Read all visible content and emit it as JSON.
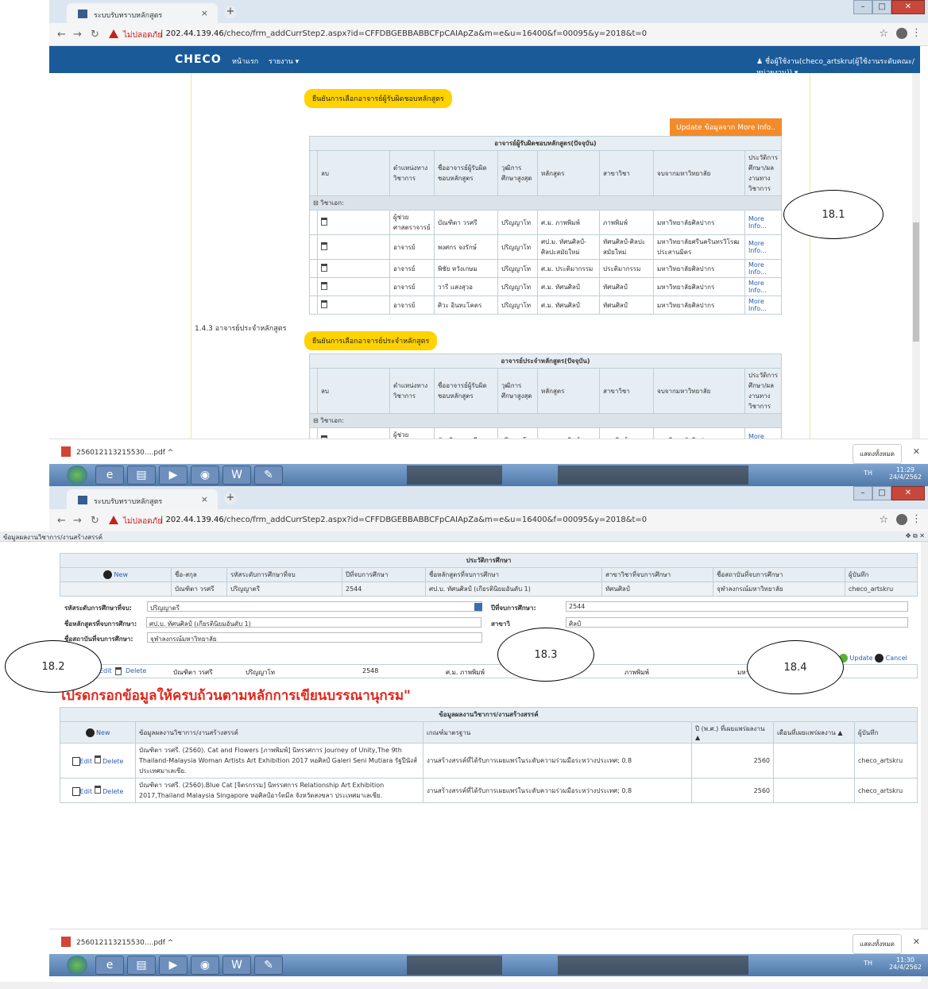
{
  "browser1": {
    "tab_title": "ระบบรับทราบหลักสูตร",
    "insecure_label": "ไม่ปลอดภัย",
    "url_host": "202.44.139.46",
    "url_path": "/checo/frm_addCurrStep2.aspx?id=CFFDBGEBBABBCFpCAIApZa&m=e&u=16400&f=00095&y=2018&t=0",
    "nav": {
      "logo": "CHECO",
      "home": "หน้าแรก",
      "report": "รายงาน ▾",
      "user": "♟ ชื่อผู้ใช้งาน(checo_artskru(ผู้ใช้งานระดับคณะ/หน่วยงาน)) ▾"
    },
    "confirm_btn": "ยืนยันการเลือกอาจารย์ผู้รับผิดชอบหลักสูตร",
    "update_btn": "Update ข้อมูลจาก More Info..",
    "section_143": "1.4.3 อาจารย์ประจำหลักสูตร",
    "confirm_btn2": "ยืนยันการเลือกอาจารย์ประจำหลักสูตร",
    "table1": {
      "caption": "อาจารย์ผู้รับผิดชอบหลักสูตร(ปัจจุบัน)",
      "headers": [
        "ลบ",
        "ตำแหน่งทางวิชาการ",
        "ชื่ออาจารย์ผู้รับผิดชอบหลักสูตร",
        "วุฒิการศึกษาสูงสุด",
        "หลักสูตร",
        "สาขาวิชา",
        "จบจากมหาวิทยาลัย",
        "ประวัติการศึกษา/ผลงานทางวิชาการ"
      ],
      "group": "⊟  วิชาเอก:",
      "rows": [
        [
          "ผู้ช่วยศาสตราจารย์",
          "บัณฑิตา วรศรี",
          "ปริญญาโท",
          "ศ.ม. ภาพพิมพ์",
          "ภาพพิมพ์",
          "มหาวิทยาลัยศิลปากร",
          "More Info..."
        ],
        [
          "อาจารย์",
          "พงศกร จงรักษ์",
          "ปริญญาโท",
          "ศป.ม. ทัศนศิลป์-ศิลปะสมัยใหม่",
          "ทัศนศิลป์-ศิลปะสมัยใหม่",
          "มหาวิทยาลัยศรีนครินทรวิโรฒประสานมิตร",
          "More Info..."
        ],
        [
          "อาจารย์",
          "พิชัย หวังเกษม",
          "ปริญญาโท",
          "ศ.ม. ประติมากรรม",
          "ประติมากรรม",
          "มหาวิทยาลัยศิลปากร",
          "More Info..."
        ],
        [
          "อาจารย์",
          "วารี แสงสุวอ",
          "ปริญญาโท",
          "ศ.ม. ทัศนศิลป์",
          "ทัศนศิลป์",
          "มหาวิทยาลัยศิลปากร",
          "More Info..."
        ],
        [
          "อาจารย์",
          "ศิวะ อินทะโคตร",
          "ปริญญาโท",
          "ศ.ม. ทัศนศิลป์",
          "ทัศนศิลป์",
          "มหาวิทยาลัยศิลปากร",
          "More Info..."
        ]
      ]
    },
    "table2": {
      "caption": "อาจารย์ประจำหลักสูตร(ปัจจุบัน)",
      "group": "⊟  วิชาเอก:",
      "rows": [
        [
          "ผู้ช่วยศาสตราจารย์",
          "บัณฑิตา วรศรี",
          "ปริญญาโท",
          "ศ.ม. ภาพพิมพ์",
          "ภาพพิมพ์",
          "มหาวิทยาลัยศิลปากร",
          "More Info..."
        ]
      ]
    },
    "download": "256012113215530....pdf  ^",
    "show_all": "แสดงทั้งหมด",
    "tray": "TH",
    "clock_time": "11:29",
    "clock_date": "24/4/2562"
  },
  "browser2": {
    "tab_title": "ระบบรับทราบหลักสูตร",
    "insecure_label": "ไม่ปลอดภัย",
    "url_host": "202.44.139.46",
    "url_path": "/checo/frm_addCurrStep2.aspx?id=CFFDBGEBBABBCFpCAIApZa&m=e&u=16400&f=00095&y=2018&t=0",
    "dialog_title": "ข้อมูลผลงานวิชาการ/งานสร้างสรรค์",
    "edu": {
      "caption": "ประวัติการศึกษา",
      "new": "New",
      "headers": [
        "ชื่อ-สกุล",
        "รหัสระดับการศึกษาที่จบ",
        "ปีที่จบการศึกษา",
        "ชื่อหลักสูตรที่จบการศึกษา",
        "สาขาวิชาที่จบการศึกษา",
        "ชื่อสถาบันที่จบการศึกษา",
        "ผู้บันทึก"
      ],
      "row": [
        "บัณฑิตา วรศรี",
        "ปริญญาตรี",
        "2544",
        "ศป.บ. ทัศนศิลป์ (เกียรตินิยมอันดับ 1)",
        "ทัศนศิลป์",
        "จุฬาลงกรณ์มหาวิทยาลัย",
        "checo_artskru"
      ],
      "row2": [
        "บัณฑิตา วรศรี",
        "ปริญญาโท",
        "2548",
        "ศ.ม. ภาพพิมพ์",
        "ภาพพิมพ์",
        "มหา"
      ],
      "edit": "Edit",
      "delete": "Delete"
    },
    "form": {
      "level_label": "รหัสระดับการศึกษาที่จบ:",
      "level_value": "ปริญญาตรี",
      "year_label": "ปีที่จบการศึกษา:",
      "year_value": "2544",
      "course_label": "ชื่อหลักสูตรที่จบการศึกษา:",
      "course_value": "ศป.บ. ทัศนศิลป์ (เกียรตินิยมอันดับ 1)",
      "major_label": "สาขาวิ",
      "major_value": "ศิลป์",
      "inst_label": "ชื่อสถาบันที่จบการศึกษา:",
      "inst_value": "จุฬาลงกรณ์มหาวิทยาลัย",
      "update": "Update",
      "cancel": "Cancel"
    },
    "red_notice": "โปรดกรอกข้อมูลให้ครบถ้วนตามหลักการเขียนบรรณานุกรม\"",
    "works": {
      "caption": "ข้อมูลผลงานวิชาการ/งานสร้างสรรค์",
      "new": "New",
      "headers": [
        "ข้อมูลผลงานวิชาการ/งานสร้างสรรค์",
        "เกณฑ์มาตรฐาน",
        "ปี (พ.ศ.) ที่เผยแพร่ผลงาน ▲",
        "เดือนที่เผยแพร่ผลงาน ▲",
        "ผู้บันทึก"
      ],
      "rows": [
        [
          "บัณฑิตา วรศรี. (2560). Cat and Flowers [ภาพพิมพ์] นิทรรศการ Journey of Unity,The 9th Thailand-Malaysia Woman Artists Art Exhibition 2017 หอศิลป์ Galeri Seni Mutiara รัฐปีนังส์ ประเทศมาเลเซีย.",
          "งานสร้างสรรค์ที่ได้รับการเผยแพร่ในระดับความร่วมมือระหว่างประเทศ; 0.8",
          "2560",
          "",
          "checo_artskru"
        ],
        [
          "บัณฑิตา วรศรี. (2560).Blue Cat [จิตรกรรม] นิทรรศการ Relationship Art Exhibition 2017,Thailand Malaysia Singapore หอศิลป์อาร์ตมีล จังหวัดสงขลา ประเทศมาเลเซีย.",
          "งานสร้างสรรค์ที่ได้รับการเผยแพร่ในระดับความร่วมมือระหว่างประเทศ; 0.8",
          "2560",
          "",
          "checo_artskru"
        ]
      ],
      "edit": "Edit",
      "delete": "Delete"
    },
    "download": "256012113215530....pdf  ^",
    "show_all": "แสดงทั้งหมด",
    "tray": "TH",
    "clock_time": "11:30",
    "clock_date": "24/4/2562"
  },
  "annotations": [
    "18.1",
    "18.2",
    "18.3",
    "18.4"
  ]
}
